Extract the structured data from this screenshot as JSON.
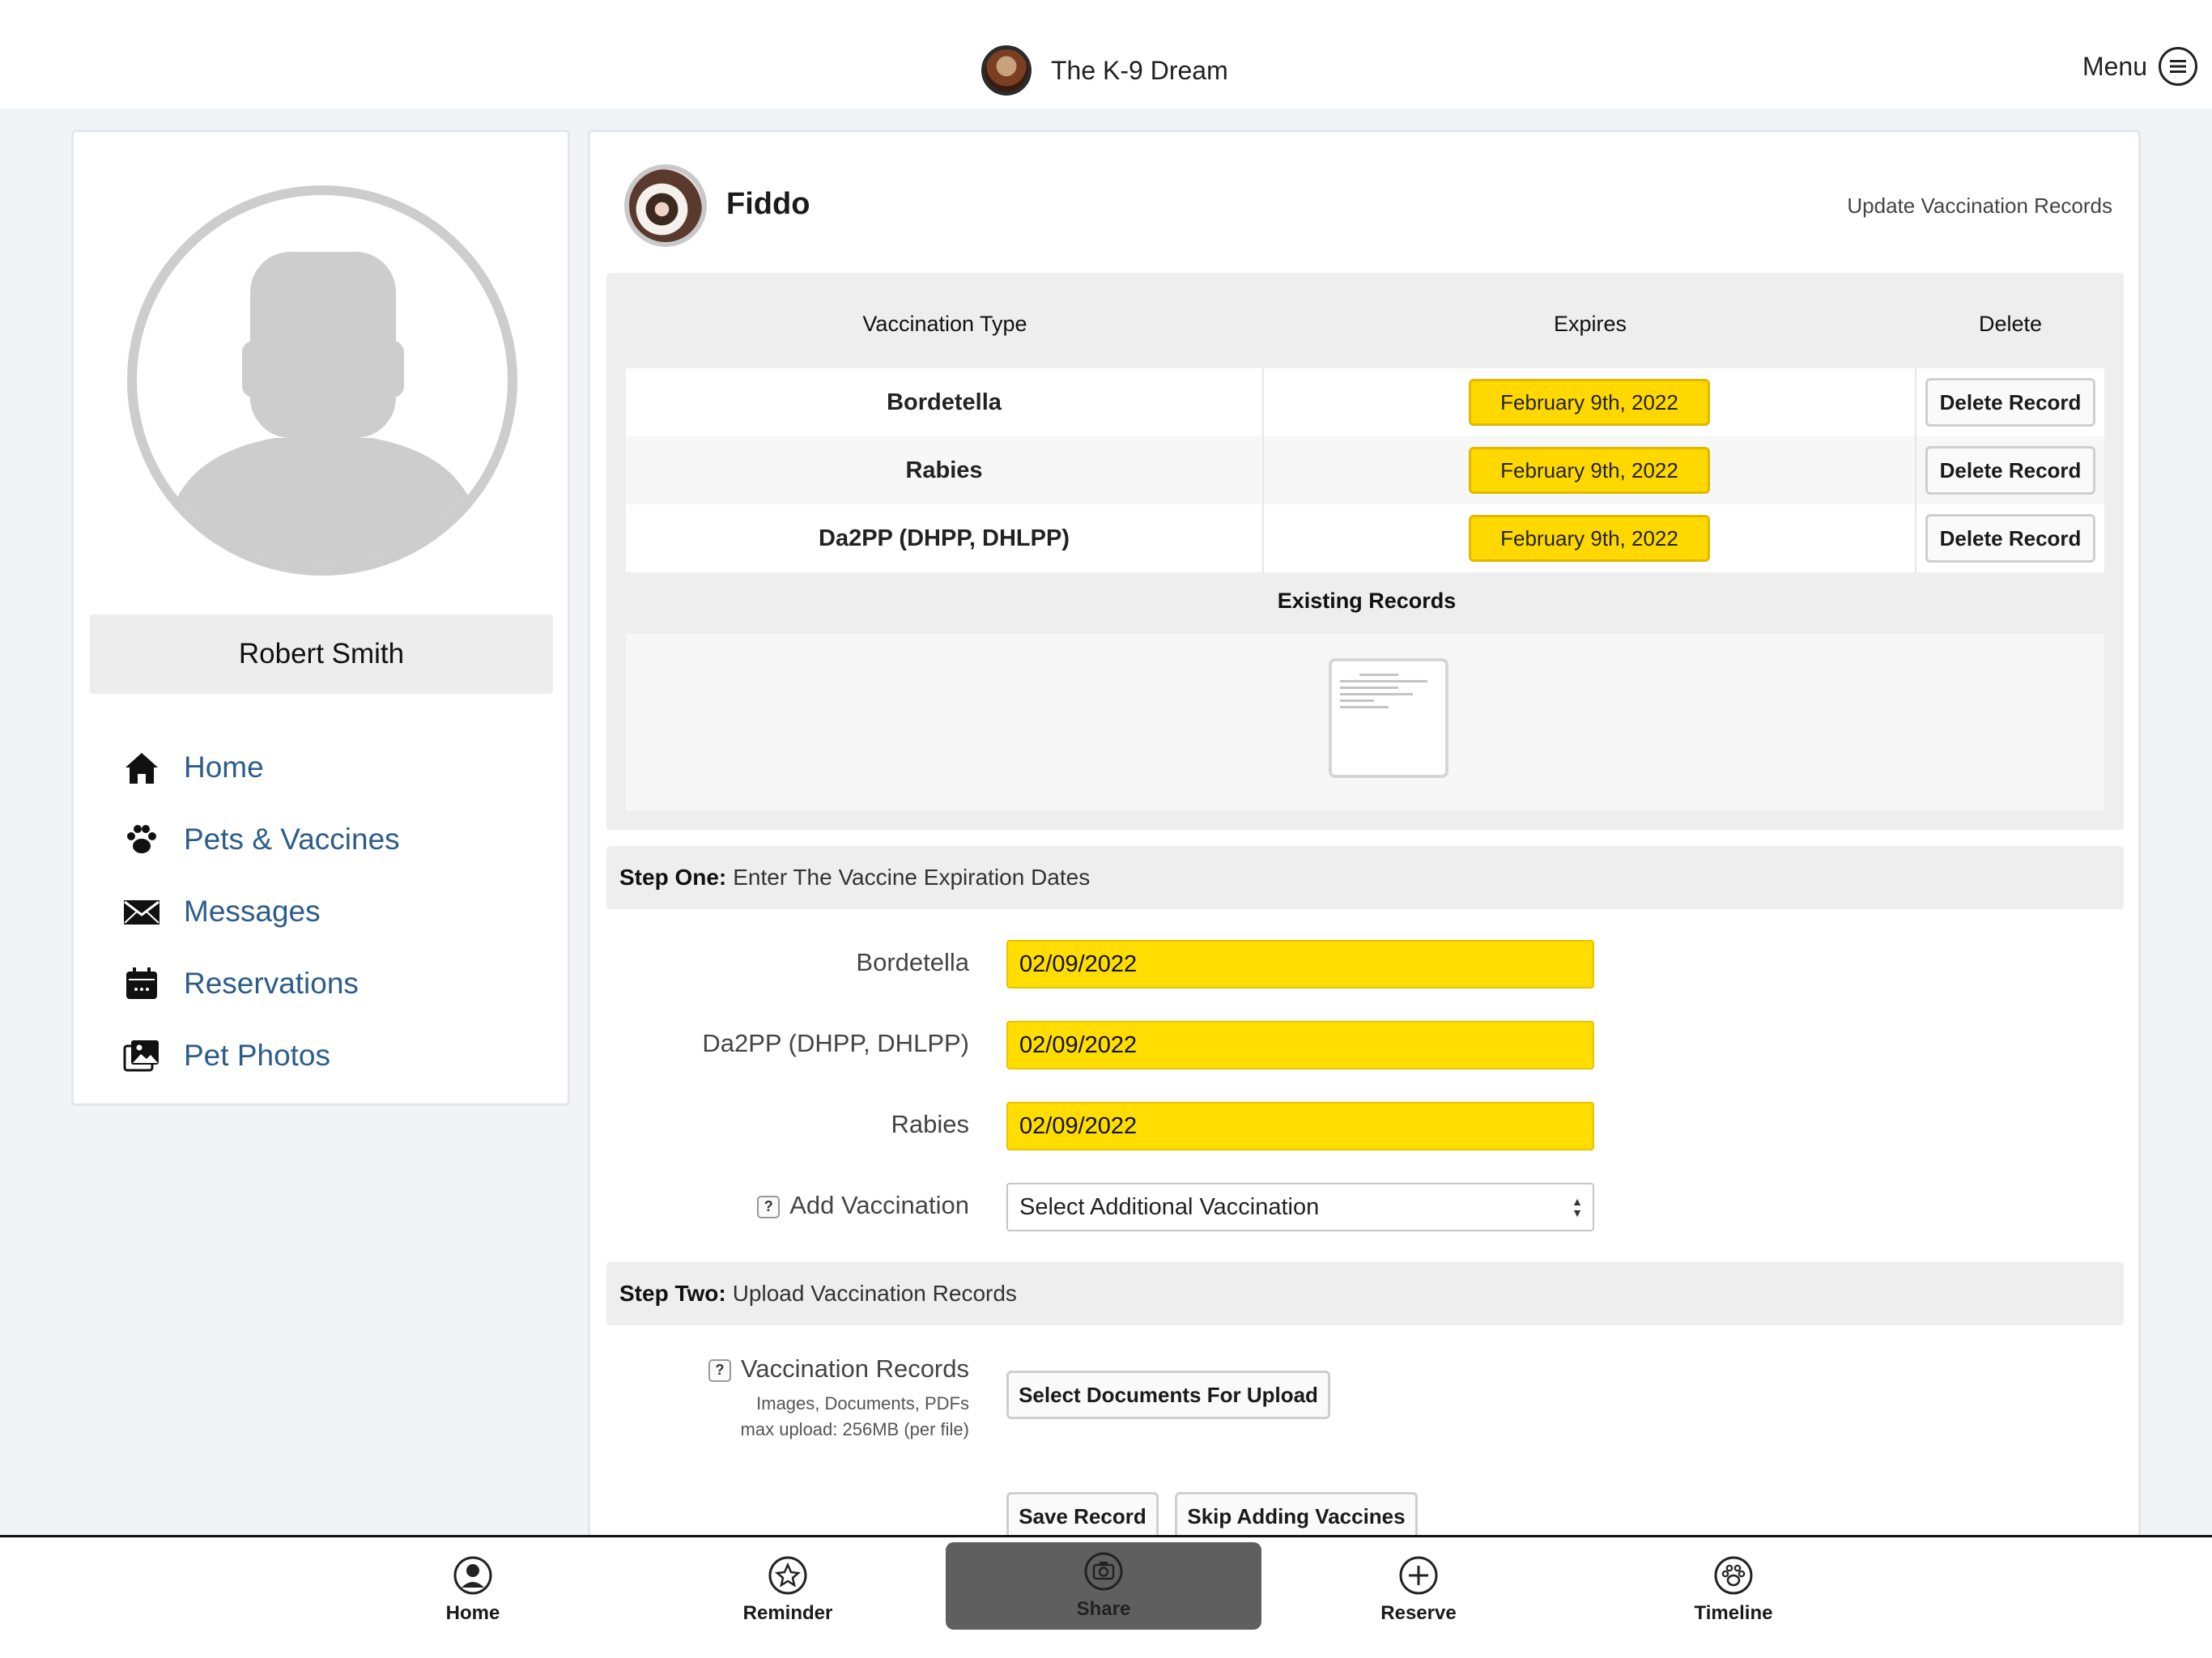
{
  "header": {
    "app_title": "The K-9 Dream",
    "menu_label": "Menu"
  },
  "profile": {
    "user_name": "Robert Smith",
    "nav": [
      {
        "label": "Home",
        "icon": "house-icon"
      },
      {
        "label": "Pets & Vaccines",
        "icon": "paw-icon"
      },
      {
        "label": "Messages",
        "icon": "envelope-icon"
      },
      {
        "label": "Reservations",
        "icon": "calendar-icon"
      },
      {
        "label": "Pet Photos",
        "icon": "photos-icon"
      }
    ]
  },
  "pet": {
    "name": "Fiddo",
    "update_link": "Update Vaccination Records"
  },
  "table": {
    "headers": [
      "Vaccination Type",
      "Expires",
      "Delete"
    ],
    "rows": [
      {
        "type": "Bordetella",
        "expires": "February 9th, 2022",
        "action": "Delete Record"
      },
      {
        "type": "Rabies",
        "expires": "February 9th, 2022",
        "action": "Delete Record"
      },
      {
        "type": "Da2PP (DHPP, DHLPP)",
        "expires": "February 9th, 2022",
        "action": "Delete Record"
      }
    ],
    "existing_records_label": "Existing Records"
  },
  "step_one": {
    "title": "Step One:",
    "text": "Enter The Vaccine Expiration Dates",
    "fields": [
      {
        "label": "Bordetella",
        "value": "02/09/2022"
      },
      {
        "label": "Da2PP (DHPP, DHLPP)",
        "value": "02/09/2022"
      },
      {
        "label": "Rabies",
        "value": "02/09/2022"
      }
    ],
    "add_vaccination_label": "Add Vaccination",
    "add_vaccination_select": "Select Additional Vaccination",
    "help_glyph": "?"
  },
  "step_two": {
    "title": "Step Two:",
    "text": "Upload Vaccination Records",
    "records_label": "Vaccination Records",
    "hint_types": "Images, Documents, PDFs",
    "hint_max": "max upload: 256MB (per file)",
    "upload_button": "Select Documents For Upload",
    "save_button": "Save Record",
    "skip_button": "Skip Adding Vaccines"
  },
  "tabbar": {
    "tabs": [
      {
        "label": "Home",
        "icon": "person-circle-icon"
      },
      {
        "label": "Reminder",
        "icon": "star-icon"
      },
      {
        "label": "Share",
        "icon": "camera-icon",
        "active": true
      },
      {
        "label": "Reserve",
        "icon": "plus-circle-icon"
      },
      {
        "label": "Timeline",
        "icon": "paw-circle-icon"
      }
    ]
  },
  "colors": {
    "accent_yellow": "#ffd800",
    "nav_link": "#2c5d8a",
    "active_tab": "#5f5f5f"
  }
}
